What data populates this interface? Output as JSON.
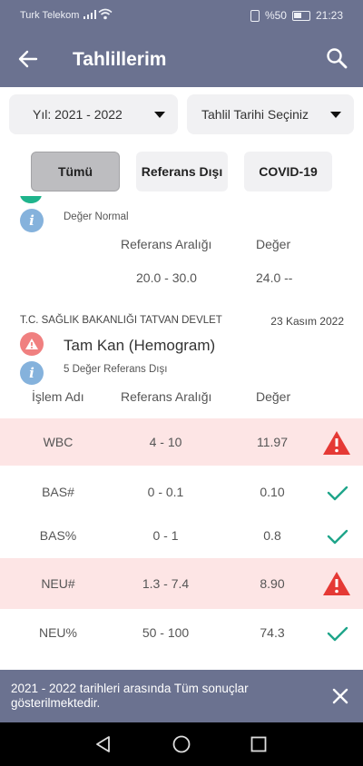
{
  "status_bar": {
    "carrier": "Turk Telekom",
    "battery": "%50",
    "time": "21:23"
  },
  "app_bar": {
    "title": "Tahlillerim",
    "back_icon": "arrow-left-icon",
    "search_icon": "search-icon"
  },
  "filters": {
    "year_select": "Yıl: 2021 - 2022",
    "date_select": "Tahlil Tarihi Seçiniz"
  },
  "tabs": [
    {
      "label": "Tümü",
      "active": true
    },
    {
      "label": "Referans Dışı",
      "active": false
    },
    {
      "label": "COVID-19",
      "active": false
    }
  ],
  "result_prev": {
    "summary": "Değer Normal",
    "col_ref": "Referans Aralığı",
    "col_value": "Değer",
    "ref": "20.0 - 30.0",
    "value": "24.0 --"
  },
  "result_main": {
    "lab": "T.C. SAĞLIK BAKANLIĞI TATVAN DEVLET",
    "date": "23 Kasım 2022",
    "test_name": "Tam Kan (Hemogram)",
    "summary": "5 Değer Referans Dışı",
    "columns": {
      "name": "İşlem Adı",
      "ref": "Referans Aralığı",
      "value": "Değer"
    },
    "rows": [
      {
        "name": "WBC",
        "ref": "4 - 10",
        "value": "11.97",
        "out_of_range": true
      },
      {
        "name": "BAS#",
        "ref": "0 - 0.1",
        "value": "0.10",
        "out_of_range": false
      },
      {
        "name": "BAS%",
        "ref": "0 - 1",
        "value": "0.8",
        "out_of_range": false
      },
      {
        "name": "NEU#",
        "ref": "1.3 - 7.4",
        "value": "8.90",
        "out_of_range": true
      },
      {
        "name": "NEU%",
        "ref": "50 - 100",
        "value": "74.3",
        "out_of_range": false
      }
    ]
  },
  "snackbar": {
    "message": "2021 - 2022 tarihleri arasında Tüm sonuçlar gösterilmektedir."
  },
  "colors": {
    "primary": "#6b7290",
    "alert_row": "#fde5e5",
    "warning": "#e53935",
    "check": "#1fa58a",
    "info": "#85b2dc"
  }
}
